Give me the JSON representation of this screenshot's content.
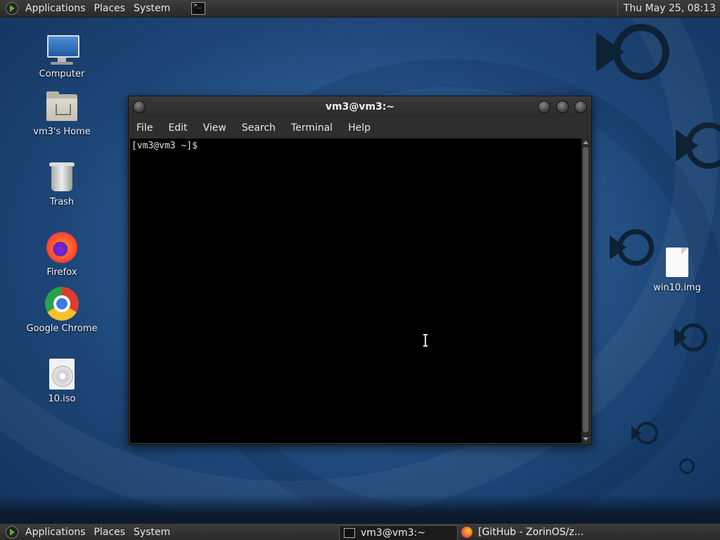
{
  "top_panel": {
    "applications": "Applications",
    "places": "Places",
    "system": "System",
    "clock": "Thu May 25, 08:13"
  },
  "bottom_panel": {
    "applications": "Applications",
    "places": "Places",
    "system": "System",
    "tasks": [
      {
        "label": "vm3@vm3:~",
        "icon": "terminal-icon",
        "active": true
      },
      {
        "label": "[GitHub - ZorinOS/z...",
        "icon": "firefox-icon",
        "active": false
      }
    ]
  },
  "desktop_icons": [
    {
      "label": "Computer",
      "icon": "computer-icon"
    },
    {
      "label": "vm3's Home",
      "icon": "home-folder-icon"
    },
    {
      "label": "Trash",
      "icon": "trash-icon"
    },
    {
      "label": "Firefox",
      "icon": "firefox-icon"
    },
    {
      "label": "Google Chrome",
      "icon": "chrome-icon"
    },
    {
      "label": "10.iso",
      "icon": "disc-image-icon"
    },
    {
      "label": "win10.img",
      "icon": "file-icon"
    }
  ],
  "terminal": {
    "title": "vm3@vm3:~",
    "menu": [
      "File",
      "Edit",
      "View",
      "Search",
      "Terminal",
      "Help"
    ],
    "prompt": "[vm3@vm3 ~]$"
  },
  "colors": {
    "panel": "#2a2a2a",
    "desktop": "#2e5f96",
    "terminal_bg": "#000000",
    "zorin_green": "#6ba83a"
  }
}
